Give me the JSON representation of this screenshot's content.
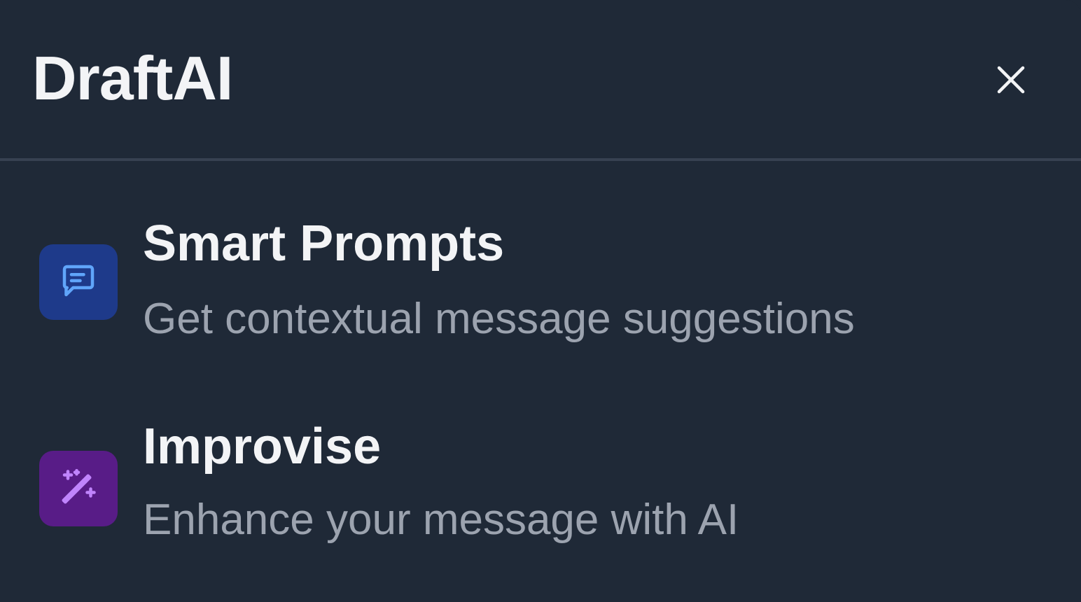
{
  "header": {
    "title": "DraftAI",
    "close_icon": "close-icon"
  },
  "menu": {
    "items": [
      {
        "title": "Smart Prompts",
        "description": "Get contextual message suggestions",
        "icon": "chat-message-icon",
        "tile_color": "#1e3a8a",
        "icon_color": "#60a5fa"
      },
      {
        "title": "Improvise",
        "description": "Enhance your message with AI",
        "icon": "magic-wand-icon",
        "tile_color": "#581c87",
        "icon_color": "#c084fc"
      }
    ]
  },
  "colors": {
    "background": "#1f2937",
    "divider": "#374151",
    "text_primary": "#f3f4f6",
    "text_secondary": "#9ca3af"
  }
}
